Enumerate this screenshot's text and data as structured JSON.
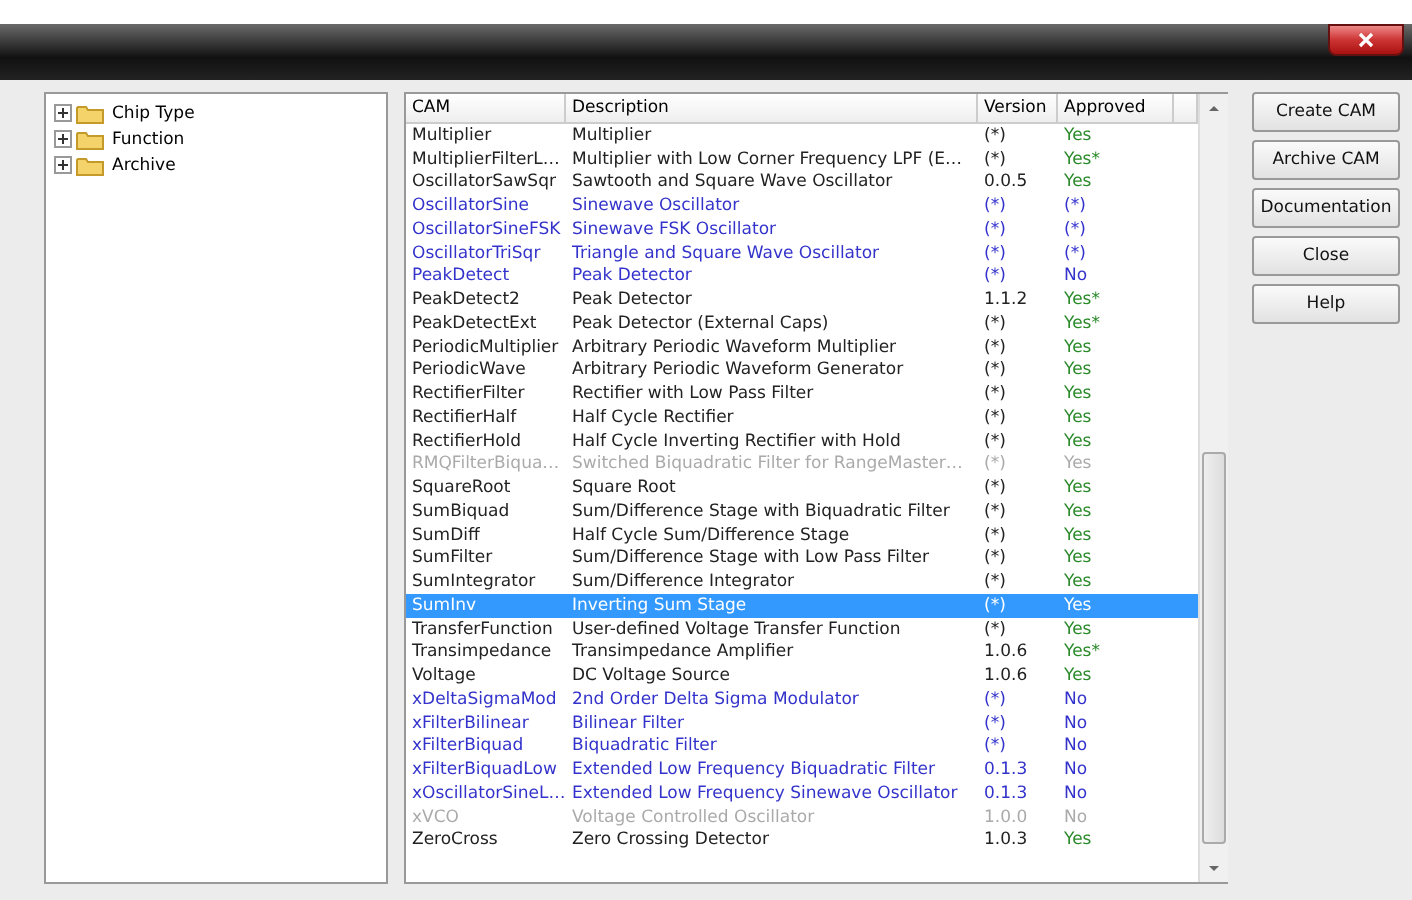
{
  "tree": [
    {
      "label": "Chip Type",
      "expanded": false
    },
    {
      "label": "Function",
      "expanded": false
    },
    {
      "label": "Archive",
      "expanded": false
    }
  ],
  "table": {
    "columns": [
      "CAM",
      "Description",
      "Version",
      "Approved"
    ],
    "rows": [
      {
        "kind": "standard",
        "selected": false,
        "cells": [
          "Multiplier",
          "Multiplier",
          "(*)",
          "Yes"
        ]
      },
      {
        "kind": "standard",
        "selected": false,
        "cells": [
          "MultiplierFilterL…",
          "Multiplier with Low Corner Frequency LPF (E…",
          "(*)",
          "Yes*"
        ]
      },
      {
        "kind": "standard",
        "selected": false,
        "cells": [
          "OscillatorSawSqr",
          "Sawtooth and Square Wave Oscillator",
          "0.0.5",
          "Yes"
        ]
      },
      {
        "kind": "user",
        "selected": false,
        "cells": [
          "OscillatorSine",
          "Sinewave Oscillator",
          "(*)",
          "(*)"
        ]
      },
      {
        "kind": "user",
        "selected": false,
        "cells": [
          "OscillatorSineFSK",
          "Sinewave FSK Oscillator",
          "(*)",
          "(*)"
        ]
      },
      {
        "kind": "user",
        "selected": false,
        "cells": [
          "OscillatorTriSqr",
          "Triangle and Square Wave Oscillator",
          "(*)",
          "(*)"
        ]
      },
      {
        "kind": "user",
        "selected": false,
        "cells": [
          "PeakDetect",
          "Peak Detector",
          "(*)",
          "No"
        ]
      },
      {
        "kind": "standard",
        "selected": false,
        "cells": [
          "PeakDetect2",
          "Peak Detector",
          "1.1.2",
          "Yes*"
        ]
      },
      {
        "kind": "standard",
        "selected": false,
        "cells": [
          "PeakDetectExt",
          "Peak Detector (External Caps)",
          "(*)",
          "Yes*"
        ]
      },
      {
        "kind": "standard",
        "selected": false,
        "cells": [
          "PeriodicMultiplier",
          "Arbitrary Periodic Waveform Multiplier",
          "(*)",
          "Yes"
        ]
      },
      {
        "kind": "standard",
        "selected": false,
        "cells": [
          "PeriodicWave",
          "Arbitrary Periodic Waveform Generator",
          "(*)",
          "Yes"
        ]
      },
      {
        "kind": "standard",
        "selected": false,
        "cells": [
          "RectifierFilter",
          "Rectifier with Low Pass Filter",
          "(*)",
          "Yes"
        ]
      },
      {
        "kind": "standard",
        "selected": false,
        "cells": [
          "RectifierHalf",
          "Half Cycle Rectifier",
          "(*)",
          "Yes"
        ]
      },
      {
        "kind": "standard",
        "selected": false,
        "cells": [
          "RectifierHold",
          "Half Cycle Inverting Rectifier with Hold",
          "(*)",
          "Yes"
        ]
      },
      {
        "kind": "disabled",
        "selected": false,
        "cells": [
          "RMQFilterBiqua…",
          "Switched Biquadratic Filter for RangeMaster…",
          "(*)",
          "Yes"
        ]
      },
      {
        "kind": "standard",
        "selected": false,
        "cells": [
          "SquareRoot",
          "Square Root",
          "(*)",
          "Yes"
        ]
      },
      {
        "kind": "standard",
        "selected": false,
        "cells": [
          "SumBiquad",
          "Sum/Difference Stage with Biquadratic Filter",
          "(*)",
          "Yes"
        ]
      },
      {
        "kind": "standard",
        "selected": false,
        "cells": [
          "SumDiff",
          "Half Cycle Sum/Difference Stage",
          "(*)",
          "Yes"
        ]
      },
      {
        "kind": "standard",
        "selected": false,
        "cells": [
          "SumFilter",
          "Sum/Difference Stage with Low Pass Filter",
          "(*)",
          "Yes"
        ]
      },
      {
        "kind": "standard",
        "selected": false,
        "cells": [
          "SumIntegrator",
          "Sum/Difference Integrator",
          "(*)",
          "Yes"
        ]
      },
      {
        "kind": "standard",
        "selected": true,
        "cells": [
          "SumInv",
          "Inverting Sum Stage",
          "(*)",
          "Yes"
        ]
      },
      {
        "kind": "standard",
        "selected": false,
        "cells": [
          "TransferFunction",
          "User-defined Voltage Transfer Function",
          "(*)",
          "Yes"
        ]
      },
      {
        "kind": "standard",
        "selected": false,
        "cells": [
          "Transimpedance",
          "Transimpedance Amplifier",
          "1.0.6",
          "Yes*"
        ]
      },
      {
        "kind": "standard",
        "selected": false,
        "cells": [
          "Voltage",
          "DC Voltage Source",
          "1.0.6",
          "Yes"
        ]
      },
      {
        "kind": "user",
        "selected": false,
        "cells": [
          "xDeltaSigmaMod",
          "2nd Order Delta Sigma Modulator",
          "(*)",
          "No"
        ]
      },
      {
        "kind": "user",
        "selected": false,
        "cells": [
          "xFilterBilinear",
          "Bilinear Filter",
          "(*)",
          "No"
        ]
      },
      {
        "kind": "user",
        "selected": false,
        "cells": [
          "xFilterBiquad",
          "Biquadratic Filter",
          "(*)",
          "No"
        ]
      },
      {
        "kind": "user",
        "selected": false,
        "cells": [
          "xFilterBiquadLow",
          "Extended Low Frequency Biquadratic Filter",
          "0.1.3",
          "No"
        ]
      },
      {
        "kind": "user",
        "selected": false,
        "cells": [
          "xOscillatorSineL…",
          "Extended Low Frequency Sinewave Oscillator",
          "0.1.3",
          "No"
        ]
      },
      {
        "kind": "disabled",
        "selected": false,
        "cells": [
          "xVCO",
          "Voltage Controlled Oscillator",
          "1.0.0",
          "No"
        ]
      },
      {
        "kind": "standard",
        "selected": false,
        "cells": [
          "ZeroCross",
          "Zero Crossing Detector",
          "1.0.3",
          "Yes"
        ]
      }
    ]
  },
  "buttons": [
    "Create CAM",
    "Archive CAM",
    "Documentation",
    "Close",
    "Help"
  ]
}
